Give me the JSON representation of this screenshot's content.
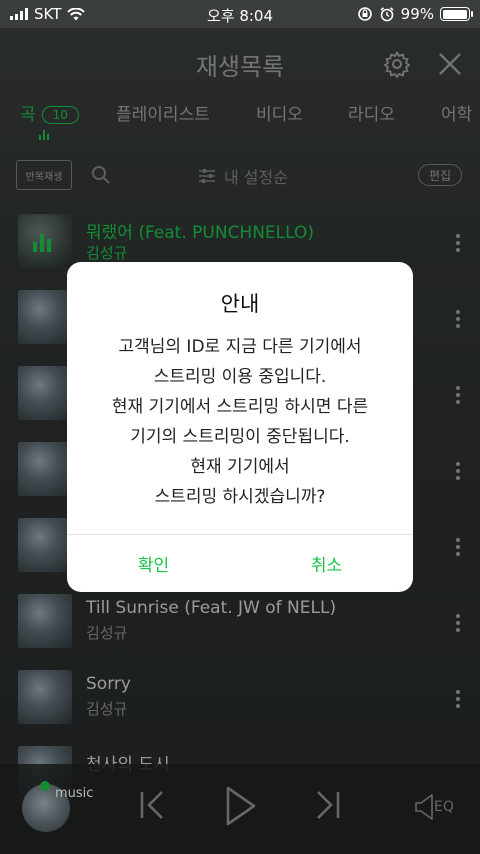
{
  "status_bar": {
    "carrier": "SKT",
    "time": "오후 8:04",
    "battery": "99%",
    "battery_level": 0.99
  },
  "header": {
    "title": "재생목록"
  },
  "tabs": [
    {
      "label": "곡",
      "count": "10",
      "active": true
    },
    {
      "label": "플레이리스트"
    },
    {
      "label": "비디오"
    },
    {
      "label": "라디오"
    },
    {
      "label": "어학"
    }
  ],
  "toolbar": {
    "repeat_label": "반복재생",
    "sort_label": "내 설정순",
    "edit_label": "편집"
  },
  "songs": [
    {
      "title": "뭐랬어 (Feat. PUNCHNELLO)",
      "artist": "김성규",
      "playing": true
    },
    {
      "title": "",
      "artist": ""
    },
    {
      "title": "",
      "artist": ""
    },
    {
      "title": "",
      "artist": ""
    },
    {
      "title": "",
      "artist": ""
    },
    {
      "title": "Till Sunrise (Feat. JW of NELL)",
      "artist": "김성규"
    },
    {
      "title": "Sorry",
      "artist": "김성규"
    },
    {
      "title": "천사의 도시",
      "artist": ""
    }
  ],
  "player": {
    "music_label": "music",
    "eq_label": "EQ"
  },
  "dialog": {
    "title": "안내",
    "message_lines": [
      "고객님의 ID로 지금 다른 기기에서",
      "스트리밍 이용 중입니다.",
      "현재 기기에서 스트리밍 하시면 다른",
      "기기의 스트리밍이 중단됩니다.",
      "현재 기기에서",
      "스트리밍 하시겠습니까?"
    ],
    "confirm_label": "확인",
    "cancel_label": "취소"
  },
  "colors": {
    "accent": "#1bc34a",
    "dialog_bg": "#ffffff",
    "muted_text": "#9ea3a1"
  }
}
